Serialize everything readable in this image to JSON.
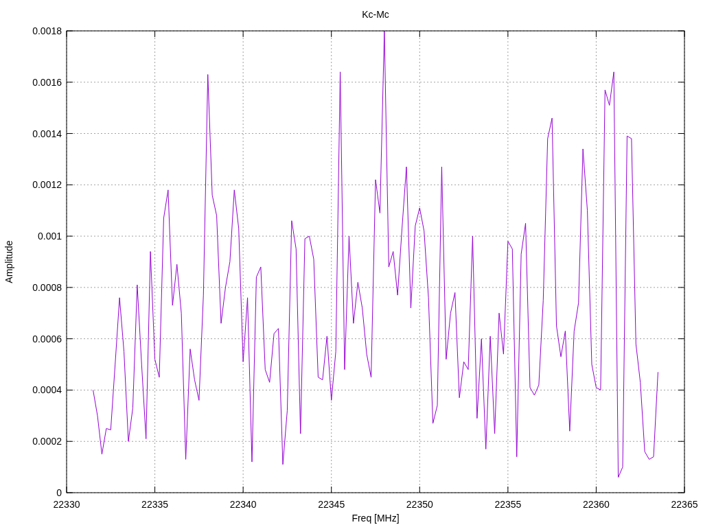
{
  "chart_data": {
    "type": "line",
    "title": "Kc-Mc",
    "xlabel": "Freq [MHz]",
    "ylabel": "Amplitude",
    "xlim": [
      22330,
      22365
    ],
    "ylim": [
      0,
      0.0018
    ],
    "grid": true,
    "xticks": [
      22330,
      22335,
      22340,
      22345,
      22350,
      22355,
      22360,
      22365
    ],
    "yticks": [
      {
        "value": 0,
        "label": "0"
      },
      {
        "value": 0.0002,
        "label": "0.0002"
      },
      {
        "value": 0.0004,
        "label": "0.0004"
      },
      {
        "value": 0.0006,
        "label": "0.0006"
      },
      {
        "value": 0.0008,
        "label": "0.0008"
      },
      {
        "value": 0.001,
        "label": "0.001"
      },
      {
        "value": 0.0012,
        "label": "0.0012"
      },
      {
        "value": 0.0014,
        "label": "0.0014"
      },
      {
        "value": 0.0016,
        "label": "0.0016"
      },
      {
        "value": 0.0018,
        "label": "0.0018"
      }
    ],
    "x": [
      22331.5,
      22331.75,
      22332,
      22332.25,
      22332.5,
      22332.75,
      22333,
      22333.25,
      22333.5,
      22333.75,
      22334,
      22334.25,
      22334.5,
      22334.75,
      22335,
      22335.25,
      22335.5,
      22335.75,
      22336,
      22336.25,
      22336.5,
      22336.75,
      22337,
      22337.25,
      22337.5,
      22337.75,
      22338,
      22338.25,
      22338.5,
      22338.75,
      22339,
      22339.25,
      22339.5,
      22339.75,
      22340,
      22340.25,
      22340.5,
      22340.75,
      22341,
      22341.25,
      22341.5,
      22341.75,
      22342,
      22342.25,
      22342.5,
      22342.75,
      22343,
      22343.25,
      22343.5,
      22343.75,
      22344,
      22344.25,
      22344.5,
      22344.75,
      22345,
      22345.25,
      22345.5,
      22345.75,
      22346,
      22346.25,
      22346.5,
      22346.75,
      22347,
      22347.25,
      22347.5,
      22347.75,
      22348,
      22348.25,
      22348.5,
      22348.75,
      22349,
      22349.25,
      22349.5,
      22349.75,
      22350,
      22350.25,
      22350.5,
      22350.75,
      22351,
      22351.25,
      22351.5,
      22351.75,
      22352,
      22352.25,
      22352.5,
      22352.75,
      22353,
      22353.25,
      22353.5,
      22353.75,
      22354,
      22354.25,
      22354.5,
      22354.75,
      22355,
      22355.25,
      22355.5,
      22355.75,
      22356,
      22356.25,
      22356.5,
      22356.75,
      22357,
      22357.25,
      22357.5,
      22357.75,
      22358,
      22358.25,
      22358.5,
      22358.75,
      22359,
      22359.25,
      22359.5,
      22359.75,
      22360,
      22360.25,
      22360.5,
      22360.75,
      22361,
      22361.25,
      22361.5,
      22361.75,
      22362,
      22362.25,
      22362.5,
      22362.75,
      22363,
      22363.25,
      22363.5
    ],
    "series": [
      {
        "color": "#9400d3",
        "values": [
          0.0004,
          0.0003,
          0.00015,
          0.00025,
          0.000245,
          0.0005,
          0.00076,
          0.00055,
          0.0002,
          0.00033,
          0.00081,
          0.0005,
          0.00021,
          0.00094,
          0.00052,
          0.00045,
          0.00107,
          0.00118,
          0.00073,
          0.00089,
          0.0007,
          0.00013,
          0.00056,
          0.00044,
          0.00036,
          0.00077,
          0.00163,
          0.00116,
          0.00108,
          0.00066,
          0.0008,
          0.0009,
          0.00118,
          0.00103,
          0.00051,
          0.00076,
          0.00012,
          0.00084,
          0.00088,
          0.00048,
          0.00043,
          0.00062,
          0.00064,
          0.00011,
          0.00032,
          0.00106,
          0.00095,
          0.00023,
          0.00099,
          0.001,
          0.00091,
          0.00045,
          0.00044,
          0.00061,
          0.00036,
          0.00055,
          0.00164,
          0.00048,
          0.001,
          0.00066,
          0.00082,
          0.00072,
          0.00054,
          0.00045,
          0.00122,
          0.00109,
          0.0018,
          0.00088,
          0.00094,
          0.00077,
          0.00103,
          0.00127,
          0.00072,
          0.00104,
          0.00111,
          0.00102,
          0.00076,
          0.00027,
          0.00034,
          0.00127,
          0.00052,
          0.0007,
          0.00078,
          0.00037,
          0.00051,
          0.00048,
          0.001,
          0.00029,
          0.0006,
          0.00017,
          0.00061,
          0.00023,
          0.0007,
          0.00054,
          0.00098,
          0.00095,
          0.00014,
          0.00093,
          0.00105,
          0.00041,
          0.00038,
          0.00042,
          0.00075,
          0.00138,
          0.00146,
          0.00065,
          0.00053,
          0.00063,
          0.00024,
          0.00063,
          0.00074,
          0.00134,
          0.0011,
          0.0005,
          0.00041,
          0.0004,
          0.00157,
          0.00151,
          0.00164,
          6e-05,
          0.0001,
          0.00139,
          0.00138,
          0.00058,
          0.00043,
          0.00016,
          0.00013,
          0.00014,
          0.00047
        ]
      }
    ]
  }
}
